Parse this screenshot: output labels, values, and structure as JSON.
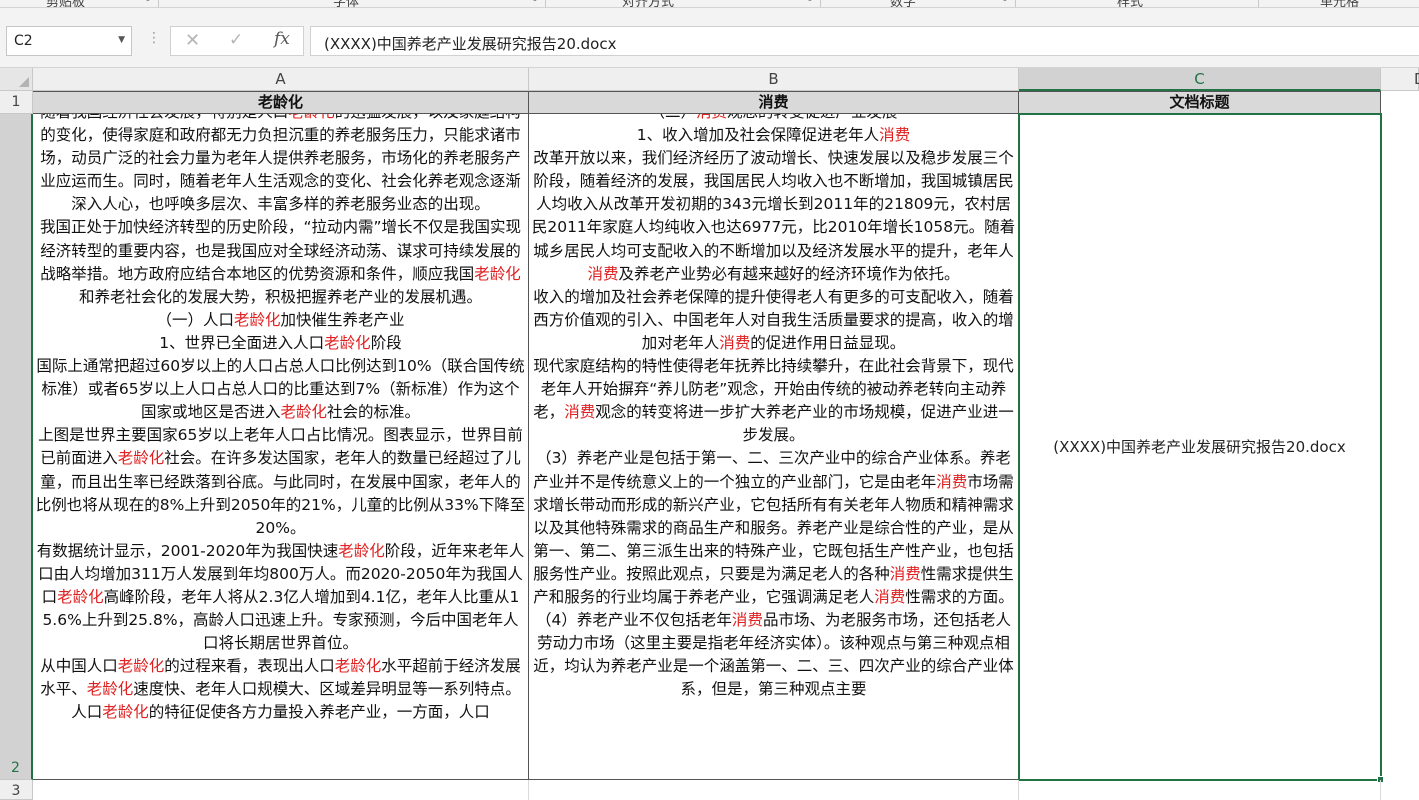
{
  "ribbon": {
    "groups": [
      "剪贴板",
      "字体",
      "对齐方式",
      "数字",
      "样式",
      "单元格"
    ]
  },
  "formula_bar": {
    "name_box": "C2",
    "cancel_icon": "✕",
    "enter_icon": "✓",
    "insert_function_icon": "fx",
    "content": "(XXXX)中国养老产业发展研究报告20.docx"
  },
  "columns": [
    "A",
    "B",
    "C",
    "D"
  ],
  "rows": [
    "1",
    "2",
    "3"
  ],
  "header_row": {
    "a": "老龄化",
    "b": "消费",
    "c": "文档标题"
  },
  "cell_a2": [
    [
      {
        "t": "随着我国经济社会发展，特别是人口"
      },
      {
        "t": "老龄化",
        "kw": true
      },
      {
        "t": "的迅猛发展，以及家庭结构的变化，使得家庭和政府都无力负担沉重的养老服务压力，只能求诸市场，动员广泛的社会力量为老年人提供养老服务，市场化的养老服务产业应运而生。同时，随着老年人生活观念的变化、社会化养老观念逐渐深入人心，也呼唤多层次、丰富多样的养老服务业态的出现。"
      }
    ],
    [
      {
        "t": "我国正处于加快经济转型的历史阶段，“拉动内需”增长不仅是我国实现经济转型的重要内容，也是我国应对全球经济动荡、谋求可持续发展的战略举措。地方政府应结合本地区的优势资源和条件，顺应我国"
      },
      {
        "t": "老龄化",
        "kw": true
      },
      {
        "t": "和养老社会化的发展大势，积极把握养老产业的发展机遇。"
      }
    ],
    [
      {
        "t": "（一）人口"
      },
      {
        "t": "老龄化",
        "kw": true
      },
      {
        "t": "加快催生养老产业"
      }
    ],
    [
      {
        "t": "1、世界已全面进入人口"
      },
      {
        "t": "老龄化",
        "kw": true
      },
      {
        "t": "阶段"
      }
    ],
    [
      {
        "t": "国际上通常把超过60岁以上的人口占总人口比例达到10%（联合国传统标准）或者65岁以上人口占总人口的比重达到7%（新标准）作为这个国家或地区是否进入"
      },
      {
        "t": "老龄化",
        "kw": true
      },
      {
        "t": "社会的标准。"
      }
    ],
    [
      {
        "t": "上图是世界主要国家65岁以上老年人口占比情况。图表显示，世界目前已前面进入"
      },
      {
        "t": "老龄化",
        "kw": true
      },
      {
        "t": "社会。在许多发达国家，老年人的数量已经超过了儿童，而且出生率已经跌落到谷底。与此同时，在发展中国家，老年人的比例也将从现在的8%上升到2050年的21%，儿童的比例从33%下降至20%。"
      }
    ],
    [
      {
        "t": "有数据统计显示，2001-2020年为我国快速"
      },
      {
        "t": "老龄化",
        "kw": true
      },
      {
        "t": "阶段，近年来老年人口由人均增加311万人发展到年均800万人。而2020-2050年为我国人口"
      },
      {
        "t": "老龄化",
        "kw": true
      },
      {
        "t": "高峰阶段，老年人将从2.3亿人增加到4.1亿，老年人比重从15.6%上升到25.8%，高龄人口迅速上升。专家预测，今后中国老年人口将长期居世界首位。"
      }
    ],
    [
      {
        "t": "从中国人口"
      },
      {
        "t": "老龄化",
        "kw": true
      },
      {
        "t": "的过程来看，表现出人口"
      },
      {
        "t": "老龄化",
        "kw": true
      },
      {
        "t": "水平超前于经济发展水平、"
      },
      {
        "t": "老龄化",
        "kw": true
      },
      {
        "t": "速度快、老年人口规模大、区域差异明显等一系列特点。"
      }
    ],
    [
      {
        "t": "人口"
      },
      {
        "t": "老龄化",
        "kw": true
      },
      {
        "t": "的特征促使各方力量投入养老产业，一方面，人口"
      }
    ]
  ],
  "cell_b2": [
    [
      {
        "t": "（二）"
      },
      {
        "t": "消费",
        "kw": true
      },
      {
        "t": "观念的转变促进产业发展"
      }
    ],
    [
      {
        "t": "1、收入增加及社会保障促进老年人"
      },
      {
        "t": "消费",
        "kw": true
      }
    ],
    [
      {
        "t": "改革开放以来，我们经济经历了波动增长、快速发展以及稳步发展三个阶段，随着经济的发展，我国居民人均收入也不断增加，我国城镇居民人均收入从改革开发初期的343元增长到2011年的21809元，农村居民2011年家庭人均纯收入也达6977元，比2010年增长1058元。随着城乡居民人均可支配收入的不断增加以及经济发展水平的提升，老年人"
      },
      {
        "t": "消费",
        "kw": true
      },
      {
        "t": "及养老产业势必有越来越好的经济环境作为依托。"
      }
    ],
    [
      {
        "t": "收入的增加及社会养老保障的提升使得老人有更多的可支配收入，随着西方价值观的引入、中国老年人对自我生活质量要求的提高，收入的增加对老年人"
      },
      {
        "t": "消费",
        "kw": true
      },
      {
        "t": "的促进作用日益显现。"
      }
    ],
    [
      {
        "t": "现代家庭结构的特性使得老年抚养比持续攀升，在此社会背景下，现代老年人开始摒弃“养儿防老”观念，开始由传统的被动养老转向主动养老，"
      },
      {
        "t": "消费",
        "kw": true
      },
      {
        "t": "观念的转变将进一步扩大养老产业的市场规模，促进产业进一步发展。"
      }
    ],
    [
      {
        "t": "（3）养老产业是包括于第一、二、三次产业中的综合产业体系。养老产业并不是传统意义上的一个独立的产业部门，它是由老年"
      },
      {
        "t": "消费",
        "kw": true
      },
      {
        "t": "市场需求增长带动而形成的新兴产业，它包括所有有关老年人物质和精神需求以及其他特殊需求的商品生产和服务。养老产业是综合性的产业，是从第一、第二、第三派生出来的特殊产业，它既包括生产性产业，也包括服务性产业。按照此观点，只要是为满足老人的各种"
      },
      {
        "t": "消费",
        "kw": true
      },
      {
        "t": "性需求提供生产和服务的行业均属于养老产业，它强调满足老人"
      },
      {
        "t": "消费",
        "kw": true
      },
      {
        "t": "性需求的方面。"
      }
    ],
    [
      {
        "t": "（4）养老产业不仅包括老年"
      },
      {
        "t": "消费",
        "kw": true
      },
      {
        "t": "品市场、为老服务市场，还包括老人劳动力市场（这里主要是指老年经济实体）。该种观点与第三种观点相近，均认为养老产业是一个涵盖第一、二、三、四次产业的综合产业体系，但是，第三种观点主要"
      }
    ]
  ],
  "cell_c2": "(XXXX)中国养老产业发展研究报告20.docx"
}
